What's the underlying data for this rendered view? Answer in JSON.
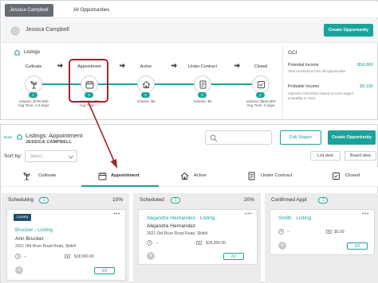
{
  "top": {
    "tabs": [
      {
        "label": "Jessica Campbell",
        "active": true
      },
      {
        "label": "All Opportunities",
        "active": false
      }
    ],
    "contact_name": "Jessica Campbell",
    "create_button": "Create Opportunity",
    "listings_label": "Listings",
    "stages": [
      {
        "name": "Cultivate",
        "count": "1",
        "volume": "Volume: $700,000",
        "avg": "Avg Time: 4.5 days"
      },
      {
        "name": "Appointment",
        "count": "3",
        "volume": "Volume: $0",
        "avg": "Avg Time: --"
      },
      {
        "name": "Active",
        "count": "0",
        "volume": "Volume: $0",
        "avg": ""
      },
      {
        "name": "Under Contract",
        "count": "0",
        "volume": "Volume: $0",
        "avg": ""
      },
      {
        "name": "Closed",
        "count": "1",
        "volume": "Volume: $500,000",
        "avg": "Avg Time: 0 days"
      }
    ],
    "gci": {
      "title": "GCI",
      "potential_label": "Potential Income",
      "potential_value": "$58,800",
      "potential_note": "Total commission from all opportunities",
      "probable_label": "Probable Income",
      "probable_value": "$8,190",
      "probable_note": "Adjusted commission based on each stage's probability to close"
    }
  },
  "bottom": {
    "back": "Back",
    "title": "Listings: Appointment",
    "subtitle": "JESSICA CAMPBELL",
    "edit_stages": "Edit Stages",
    "create_button": "Create Opportunity",
    "sort_label": "Sort by:",
    "sort_placeholder": "Select...",
    "list_view": "List view",
    "board_view": "Board view",
    "stage_tabs": [
      {
        "label": "Cultivate",
        "icon": "seedling-icon",
        "active": false
      },
      {
        "label": "Appointment",
        "icon": "calendar-icon",
        "active": true
      },
      {
        "label": "Active",
        "icon": "house-icon",
        "active": false
      },
      {
        "label": "Under Contract",
        "icon": "contract-icon",
        "active": false
      },
      {
        "label": "Closed",
        "icon": "closed-icon",
        "active": false
      }
    ],
    "columns": [
      {
        "name": "Scheduling",
        "count": "1",
        "percent": "10%"
      },
      {
        "name": "Scheduled",
        "count": "1",
        "percent": "20%"
      },
      {
        "name": "Confirmed Appt",
        "count": "1",
        "percent": ""
      }
    ],
    "cards": [
      {
        "tag": "Luxury",
        "title": "Brucker - Listing",
        "name": "Ann Brucker",
        "address": "2021 Old River Road Road, Slidell",
        "date": "--",
        "amount": "$18,900.00",
        "tasks": "2/2",
        "avatar": "A"
      },
      {
        "tag": "",
        "title": "Alejandra Hernandez - Listing",
        "name": "Alejandra Hernandez",
        "address": "2021 Old River Road Road, Slidell",
        "date": "--",
        "amount": "$18,900.00",
        "tasks": "2/2",
        "avatar": "A"
      },
      {
        "tag": "",
        "title": "Smith - Listing",
        "name": "",
        "address": "",
        "date": "--",
        "amount": "$0.00",
        "tasks": "2/2",
        "avatar": "A"
      }
    ]
  },
  "colors": {
    "accent": "#1aa39a",
    "highlight": "#a3232c"
  }
}
